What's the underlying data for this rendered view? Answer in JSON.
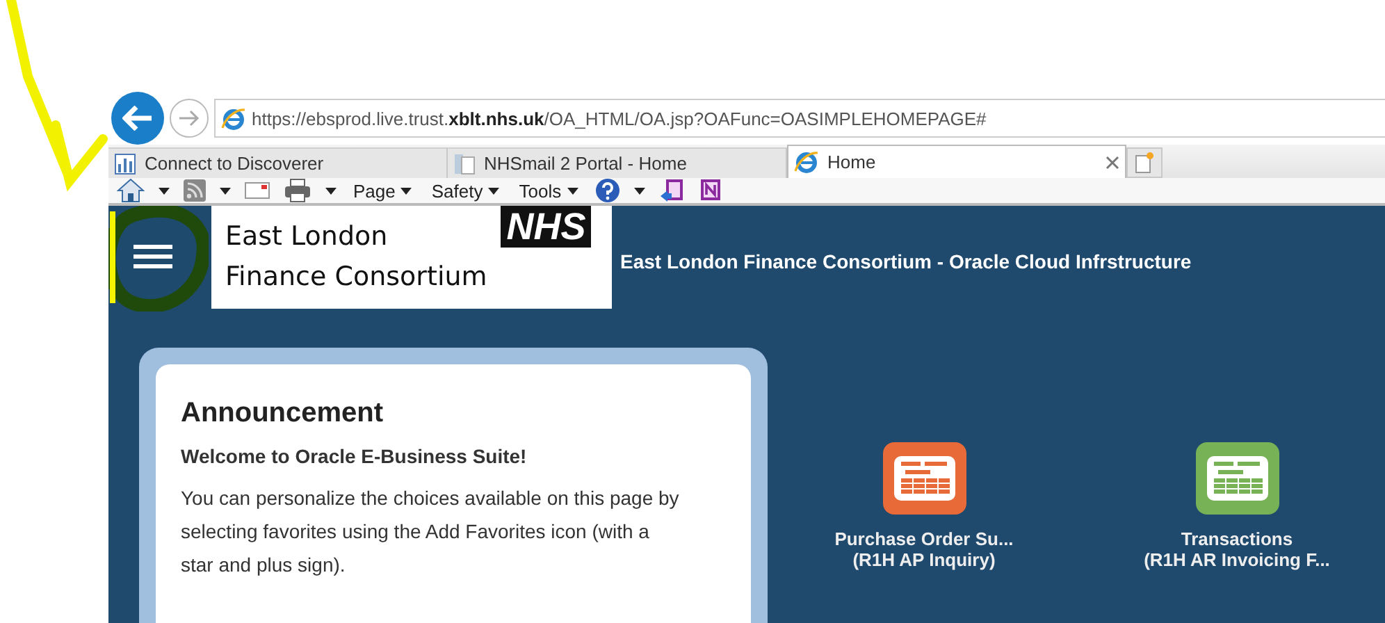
{
  "browser": {
    "address": "https://ebsprod.live.trust.**xblt.nhs.uk**/OA_HTML/OA.jsp?OAFunc=OASIMPLEHOMEPAGE#",
    "tabs": [
      {
        "label": "Connect to Discoverer",
        "selected": false,
        "kind": "chart"
      },
      {
        "label": "NHSmail 2 Portal - Home",
        "selected": false,
        "kind": "page"
      },
      {
        "label": "Home",
        "selected": true,
        "kind": "ie"
      }
    ],
    "command_bar": [
      "Page",
      "Safety",
      "Tools"
    ]
  },
  "header": {
    "logo": {
      "line_1": "East London",
      "line_2": "Finance Consortium",
      "badge": "NHS"
    },
    "title": "East London Finance Consortium - Oracle Cloud Infrstructure"
  },
  "announcement": {
    "title": "Announcement",
    "subtitle": "Welcome to Oracle E-Business Suite!",
    "body": "You can personalize the choices available on this page by selecting favorites using the Add Favorites icon (with a star and plus sign)."
  },
  "tiles": [
    {
      "title": "Purchase Order Su...",
      "subtitle": "(R1H AP Inquiry)",
      "color": "#e86a38"
    },
    {
      "title": "Transactions",
      "subtitle": "(R1H AR Invoicing F...",
      "color": "#78b257"
    }
  ]
}
